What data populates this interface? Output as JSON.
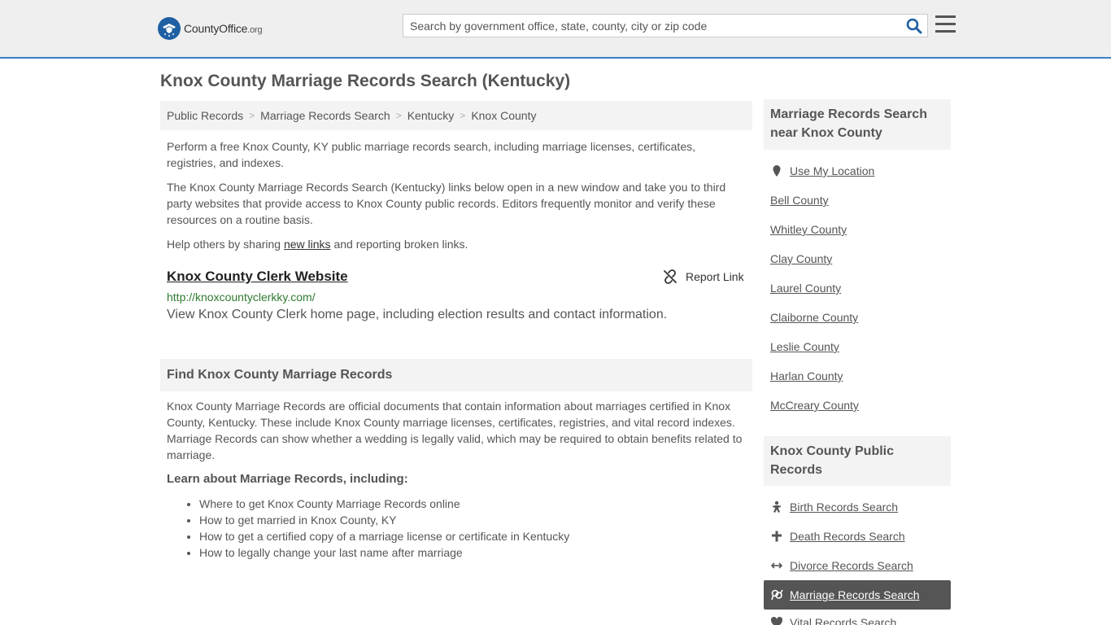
{
  "header": {
    "logo_main": "CountyOffice",
    "logo_suffix": ".org",
    "search_placeholder": "Search by government office, state, county, city or zip code"
  },
  "page": {
    "title": "Knox County Marriage Records Search (Kentucky)"
  },
  "breadcrumb": [
    "Public Records",
    "Marriage Records Search",
    "Kentucky",
    "Knox County"
  ],
  "intro": {
    "p1": "Perform a free Knox County, KY public marriage records search, including marriage licenses, certificates, registries, and indexes.",
    "p2": "The Knox County Marriage Records Search (Kentucky) links below open in a new window and take you to third party websites that provide access to Knox County public records. Editors frequently monitor and verify these resources on a routine basis.",
    "p3_before": "Help others by sharing ",
    "p3_link": "new links",
    "p3_after": " and reporting broken links."
  },
  "resource": {
    "title": "Knox County Clerk Website",
    "url": "http://knoxcountyclerkky.com/",
    "description": "View Knox County Clerk home page, including election results and contact information.",
    "report_label": "Report Link"
  },
  "find_section": {
    "heading": "Find Knox County Marriage Records",
    "body": "Knox County Marriage Records are official documents that contain information about marriages certified in Knox County, Kentucky. These include Knox County marriage licenses, certificates, registries, and vital record indexes. Marriage Records can show whether a wedding is legally valid, which may be required to obtain benefits related to marriage.",
    "learn_heading": "Learn about Marriage Records, including:",
    "learn_items": [
      "Where to get Knox County Marriage Records online",
      "How to get married in Knox County, KY",
      "How to get a certified copy of a marriage license or certificate in Kentucky",
      "How to legally change your last name after marriage"
    ]
  },
  "sidebar": {
    "nearby_heading": "Marriage Records Search near Knox County",
    "use_location": "Use My Location",
    "nearby": [
      "Bell County",
      "Whitley County",
      "Clay County",
      "Laurel County",
      "Claiborne County",
      "Leslie County",
      "Harlan County",
      "McCreary County"
    ],
    "public_heading": "Knox County Public Records",
    "public_records": [
      {
        "label": "Birth Records Search",
        "icon": "baby-icon"
      },
      {
        "label": "Death Records Search",
        "icon": "cross-icon"
      },
      {
        "label": "Divorce Records Search",
        "icon": "arrows-icon"
      },
      {
        "label": "Marriage Records Search",
        "icon": "marriage-icon"
      },
      {
        "label": "Vital Records Search",
        "icon": "heart-icon"
      }
    ]
  },
  "colors": {
    "brand_blue": "#1f5fa3",
    "header_border": "#3b7fc4",
    "url_green": "#2f7a2f",
    "active_bg": "#555555"
  }
}
